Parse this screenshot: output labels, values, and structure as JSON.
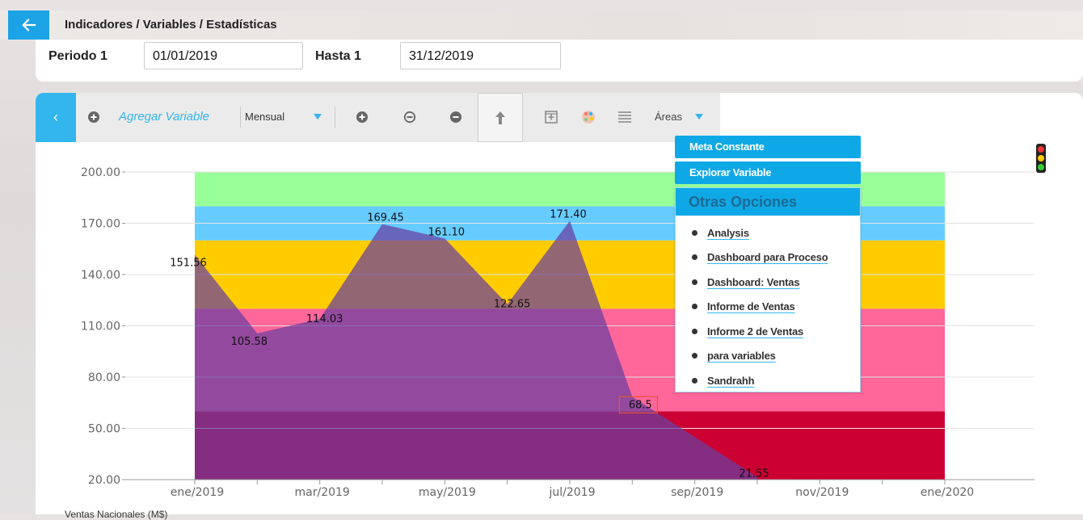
{
  "header": {
    "breadcrumb": "Indicadores / Variables / Estadísticas"
  },
  "period": {
    "label1": "Periodo 1",
    "value1": "01/01/2019",
    "label2": "Hasta 1",
    "value2": "31/12/2019"
  },
  "toolbar": {
    "add_variable": "Agregar Variable",
    "frequency": "Mensual",
    "areas": "Áreas"
  },
  "menu": {
    "meta_constante": "Meta Constante",
    "explorar_variable": "Explorar Variable",
    "otras_title": "Otras Opciones",
    "items": [
      "Analysis",
      "Dashboard para Proceso",
      "Dashboard: Ventas",
      "Informe de Ventas",
      "Informe 2 de Ventas",
      "para variables",
      "Sandrahh"
    ]
  },
  "legend": {
    "label": "Ventas Nacionales (M$)"
  },
  "colors": {
    "accent": "#1ba3e6",
    "area_color": "#6a3fa0",
    "band_green": "#99ff99",
    "band_blue": "#66ccff",
    "band_yellow": "#ffcc00",
    "band_pink": "#ff6699",
    "band_red": "#cc0033"
  },
  "chart_data": {
    "type": "area",
    "ylim": [
      20,
      200
    ],
    "ytick_labels": [
      "200.00",
      "170.00",
      "140.00",
      "110.00",
      "80.00",
      "50.00",
      "20.00"
    ],
    "xtick_labels": [
      "ene/2019",
      "mar/2019",
      "may/2019",
      "jul/2019",
      "sep/2019",
      "nov/2019",
      "ene/2020"
    ],
    "bands": [
      {
        "from": 20,
        "to": 60,
        "color": "#cc0033"
      },
      {
        "from": 60,
        "to": 120,
        "color": "#ff6699"
      },
      {
        "from": 120,
        "to": 160,
        "color": "#ffcc00"
      },
      {
        "from": 160,
        "to": 180,
        "color": "#66ccff"
      },
      {
        "from": 180,
        "to": 200,
        "color": "#99ff99"
      }
    ],
    "series": [
      {
        "name": "Ventas Nacionales (M$)",
        "x": [
          "ene/2019",
          "feb/2019",
          "mar/2019",
          "abr/2019",
          "may/2019",
          "jun/2019",
          "jul/2019",
          "ago/2019",
          "sep/2019",
          "oct/2019",
          "nov/2019",
          "dic/2019"
        ],
        "values": [
          151.56,
          105.58,
          114.03,
          169.45,
          161.1,
          122.65,
          171.4,
          68.5,
          45,
          21.55,
          null,
          null
        ],
        "labels": [
          "151.56",
          "105.58",
          "114.03",
          "169.45",
          "161.10",
          "122.65",
          "171.40",
          "68.5",
          "",
          "21.55",
          "",
          ""
        ]
      }
    ]
  }
}
